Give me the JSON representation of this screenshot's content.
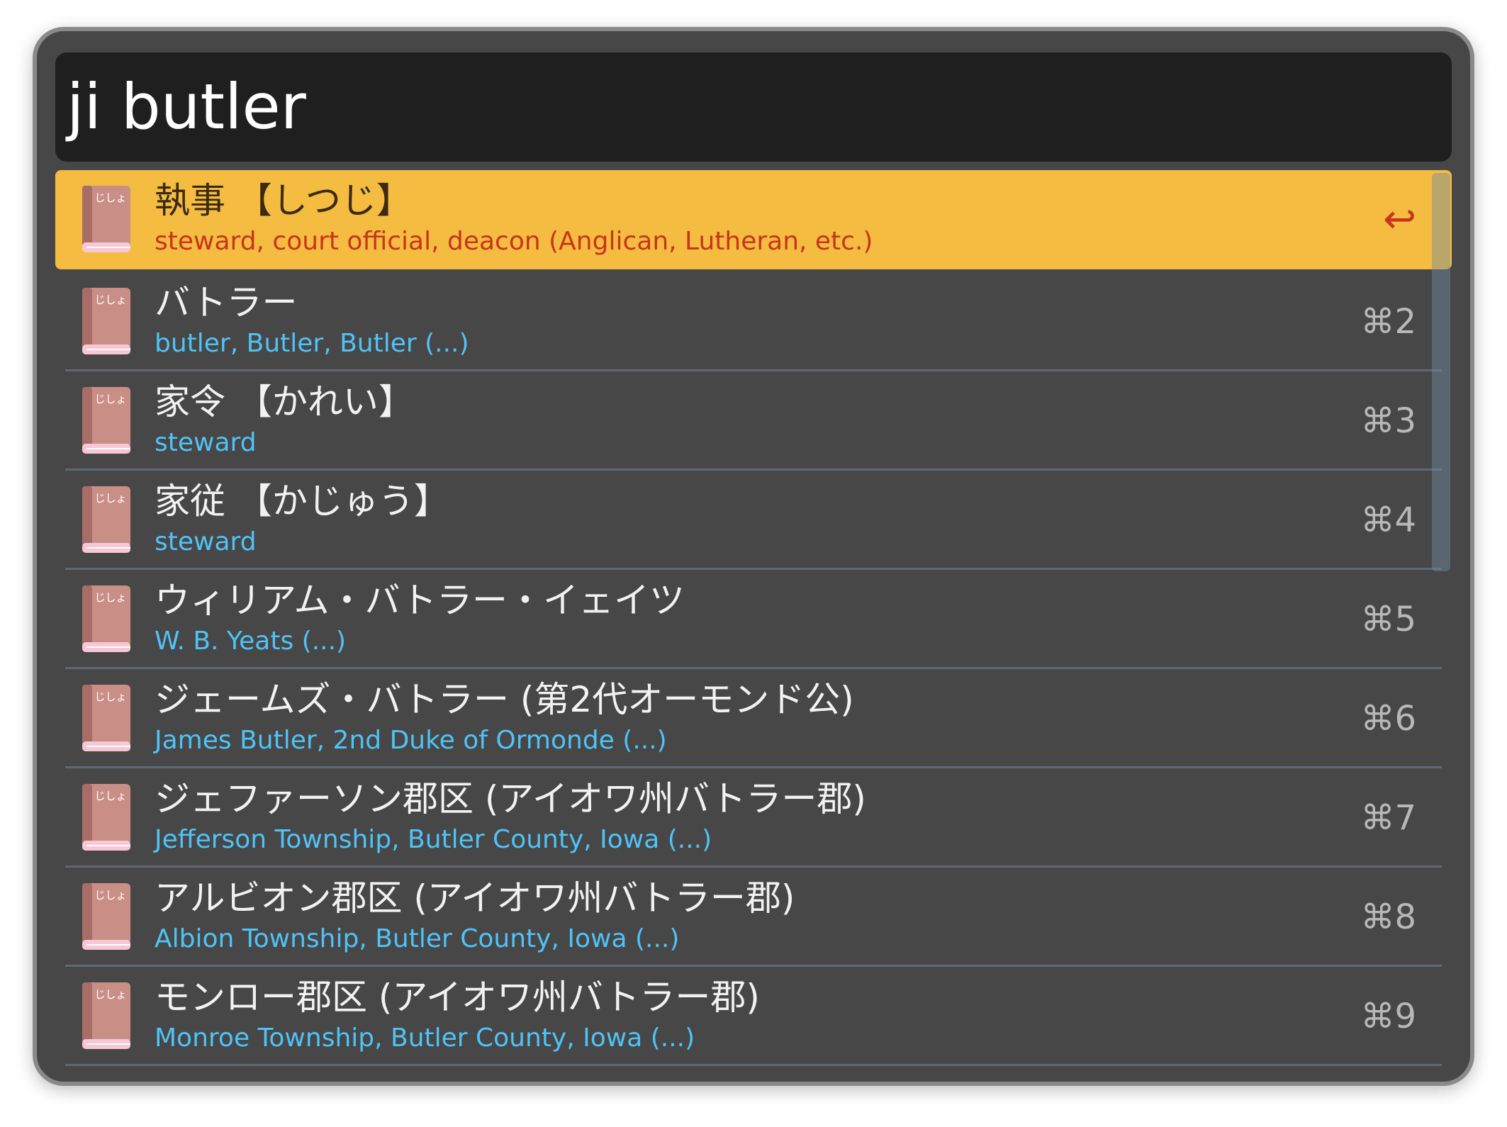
{
  "search": {
    "query": "ji butler"
  },
  "book_icon_text": "じしょ",
  "results": [
    {
      "title": "執事 【しつじ】",
      "subtitle": "steward, court official, deacon (Anglican, Lutheran, etc.)",
      "shortcut": "↩",
      "selected": true
    },
    {
      "title": "バトラー",
      "subtitle": "butler, Butler, Butler  (...)",
      "shortcut": "⌘2"
    },
    {
      "title": "家令 【かれい】",
      "subtitle": "steward",
      "shortcut": "⌘3"
    },
    {
      "title": "家従 【かじゅう】",
      "subtitle": "steward",
      "shortcut": "⌘4"
    },
    {
      "title": "ウィリアム・バトラー・イェイツ",
      "subtitle": "W. B. Yeats  (...)",
      "shortcut": "⌘5"
    },
    {
      "title": "ジェームズ・バトラー (第2代オーモンド公)",
      "subtitle": "James Butler, 2nd Duke of Ormonde  (...)",
      "shortcut": "⌘6"
    },
    {
      "title": "ジェファーソン郡区 (アイオワ州バトラー郡)",
      "subtitle": "Jefferson Township, Butler County, Iowa  (...)",
      "shortcut": "⌘7"
    },
    {
      "title": "アルビオン郡区 (アイオワ州バトラー郡)",
      "subtitle": "Albion Township, Butler County, Iowa  (...)",
      "shortcut": "⌘8"
    },
    {
      "title": "モンロー郡区 (アイオワ州バトラー郡)",
      "subtitle": "Monroe Township, Butler County, Iowa  (...)",
      "shortcut": "⌘9"
    }
  ],
  "colors": {
    "selected_background": "#f4bc41",
    "subtitle": "#4fc3f7",
    "selected_subtitle": "#c8341c",
    "window_background": "#474747",
    "search_background": "#1f1f1f"
  }
}
